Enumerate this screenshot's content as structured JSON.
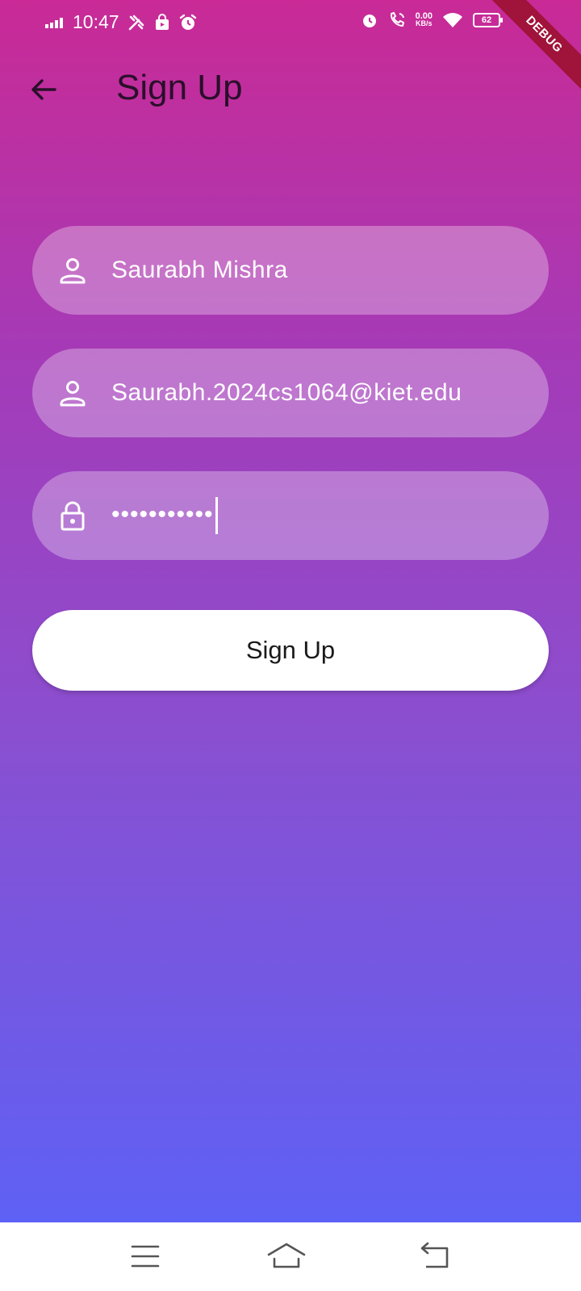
{
  "status_bar": {
    "time": "10:47",
    "net_speed_value": "0.00",
    "net_speed_unit": "KB/s",
    "battery": "62",
    "icons": [
      "signal-icon",
      "tools-icon",
      "bag-icon",
      "alarm-icon",
      "alarm-icon",
      "wifi-call-icon",
      "wifi-icon",
      "battery-icon"
    ]
  },
  "debug_banner": "DEBUG",
  "app_bar": {
    "title": "Sign Up",
    "back_icon": "arrow-back-icon"
  },
  "form": {
    "name_value": "Saurabh Mishra",
    "email_value": "Saurabh.2024cs1064@kiet.edu",
    "password_masked": "•••••••••••",
    "name_icon": "person-icon",
    "email_icon": "person-icon",
    "password_icon": "lock-icon"
  },
  "signup_button": "Sign Up",
  "nav_bar": {
    "icons": [
      "menu-icon",
      "home-icon",
      "back-icon"
    ]
  },
  "colors": {
    "gradient_top": "#c92a96",
    "gradient_mid": "#8a4fd0",
    "gradient_bottom": "#5e61f5",
    "banner": "#a0133a",
    "title": "#2a0f2a"
  }
}
